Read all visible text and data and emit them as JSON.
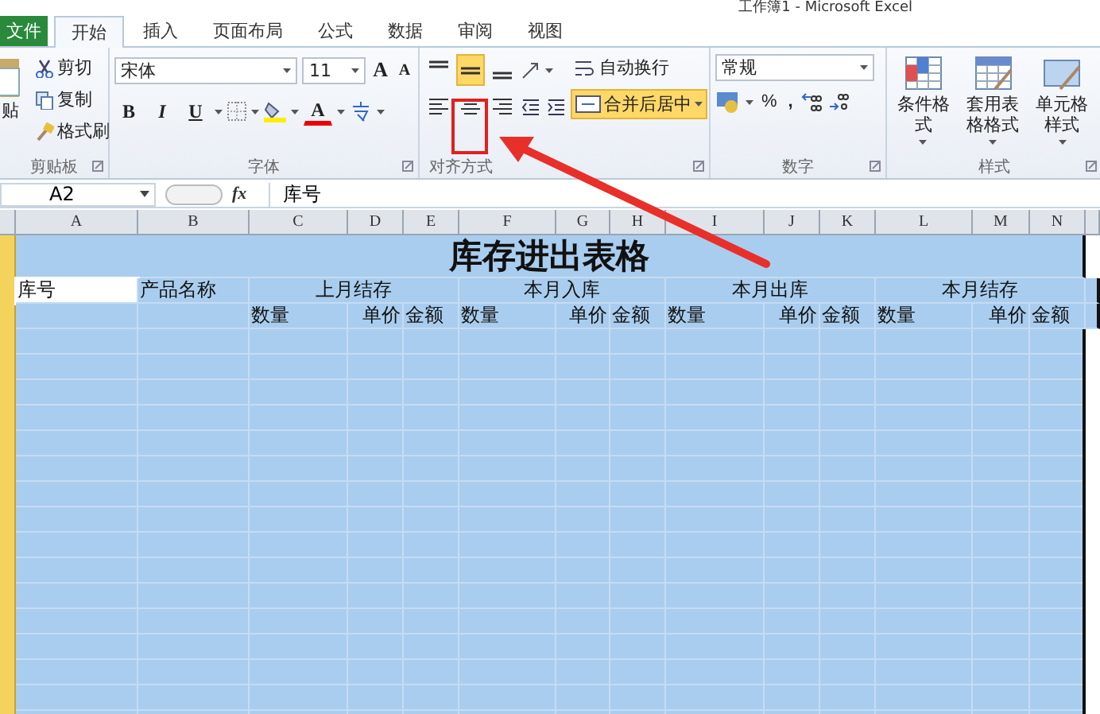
{
  "window": {
    "title": "工作簿1 - Microsoft Excel"
  },
  "tabs": [
    {
      "label": "文件",
      "kind": "file",
      "selected": false
    },
    {
      "label": "开始",
      "kind": "tab",
      "selected": true
    },
    {
      "label": "插入",
      "kind": "tab",
      "selected": false
    },
    {
      "label": "页面布局",
      "kind": "tab",
      "selected": false
    },
    {
      "label": "公式",
      "kind": "tab",
      "selected": false
    },
    {
      "label": "数据",
      "kind": "tab",
      "selected": false
    },
    {
      "label": "审阅",
      "kind": "tab",
      "selected": false
    },
    {
      "label": "视图",
      "kind": "tab",
      "selected": false
    }
  ],
  "clipboard": {
    "label": "剪贴板",
    "paste": "贴",
    "cut": "剪切",
    "copy": "复制",
    "format_painter": "格式刷"
  },
  "font": {
    "label": "字体",
    "font_name": "宋体",
    "font_size": "11",
    "grow": "A",
    "shrink": "A",
    "bold": "B",
    "italic": "I",
    "underline": "U",
    "font_color": "A"
  },
  "alignment": {
    "label": "对齐方式",
    "vertical": [
      {
        "kind": "top",
        "selected": false
      },
      {
        "kind": "middle",
        "selected": true
      },
      {
        "kind": "bottom",
        "selected": false
      }
    ],
    "horizontal": [
      {
        "kind": "left",
        "selected": false
      },
      {
        "kind": "center",
        "selected": false
      },
      {
        "kind": "right",
        "selected": false
      }
    ],
    "wrap_text": "自动换行",
    "merge_center": {
      "label": "合并后居中",
      "on": true
    }
  },
  "number": {
    "label": "数字",
    "format": "常规",
    "percent": "%",
    "comma": ","
  },
  "styles": {
    "label": "样式",
    "conditional": "条件格式",
    "table_format": "套用表格格式",
    "cell_styles": "单元格样式"
  },
  "formula_bar": {
    "name_box": "A2",
    "function_button": "fx",
    "formula": "库号"
  },
  "sheet": {
    "columns": [
      "A",
      "B",
      "C",
      "D",
      "E",
      "F",
      "G",
      "H",
      "I",
      "J",
      "K",
      "L",
      "M",
      "N"
    ],
    "title": "库存进出表格",
    "header": [
      {
        "label": "库号",
        "kind": "single",
        "selected": true
      },
      {
        "label": "产品名称",
        "kind": "single",
        "selected": false
      },
      {
        "label": "上月结存",
        "kind": "group",
        "selected": false
      },
      {
        "label": "本月入库",
        "kind": "group",
        "selected": false
      },
      {
        "label": "本月出库",
        "kind": "group",
        "selected": false
      },
      {
        "label": "本月结存",
        "kind": "group",
        "selected": false
      }
    ],
    "sub_header": [
      "数量",
      "单价",
      "金额",
      "数量",
      "单价",
      "金额",
      "数量",
      "单价",
      "金额",
      "数量",
      "单价",
      "金额"
    ]
  }
}
